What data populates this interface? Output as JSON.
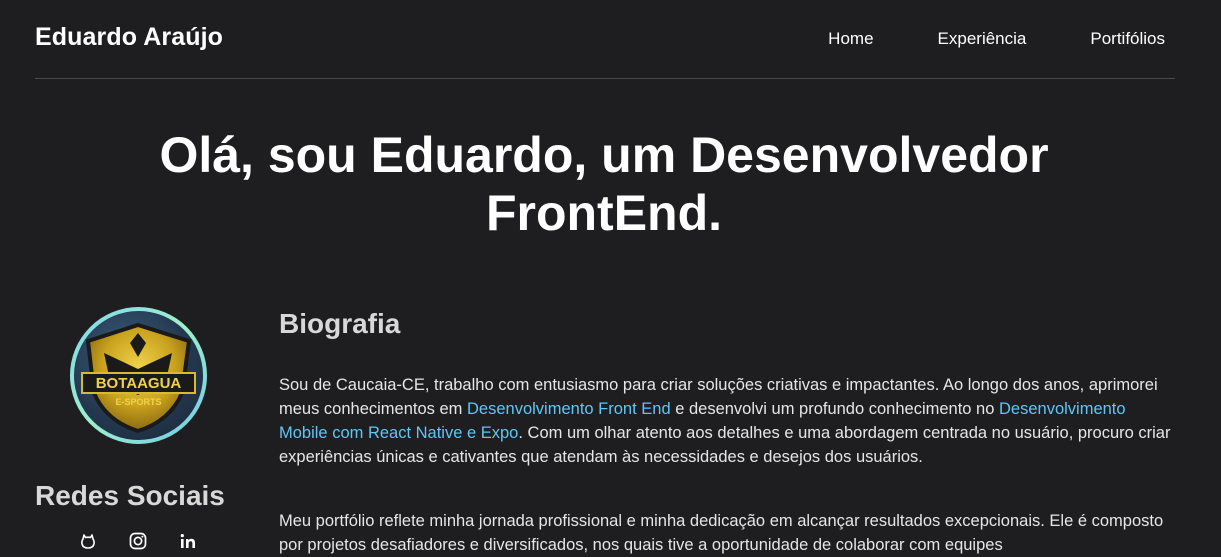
{
  "header": {
    "brand": "Eduardo Araújo",
    "nav": [
      "Home",
      "Experiência",
      "Portifólios"
    ]
  },
  "hero": {
    "line1": "Olá, sou Eduardo, um Desenvolvedor",
    "line2": "FrontEnd."
  },
  "sidebar": {
    "avatar_text": "BOTAAGUA",
    "avatar_subtext": "E-SPORTS",
    "social_title": "Redes Sociais",
    "icons": [
      "github-icon",
      "instagram-icon",
      "linkedin-icon"
    ]
  },
  "bio": {
    "title": "Biografia",
    "p1_a": "Sou de Caucaia-CE, trabalho com entusiasmo para criar soluções criativas e impactantes. Ao longo dos anos, aprimorei meus conhecimentos em ",
    "p1_link1": "Desenvolvimento Front End",
    "p1_b": " e desenvolvi um profundo conhecimento no ",
    "p1_link2": "Desenvolvimento Mobile com React Native e Expo",
    "p1_c": ". Com um olhar atento aos detalhes e uma abordagem centrada no usuário, procuro criar experiências únicas e cativantes que atendam às necessidades e desejos dos usuários.",
    "p2": "Meu portfólio reflete minha jornada profissional e minha dedicação em alcançar resultados excepcionais. Ele é composto por projetos desafiadores e diversificados, nos quais tive a oportunidade de colaborar com equipes"
  },
  "colors": {
    "background": "#1e1e20",
    "accent": "#5fc6f5",
    "divider": "#4a4a4d"
  }
}
